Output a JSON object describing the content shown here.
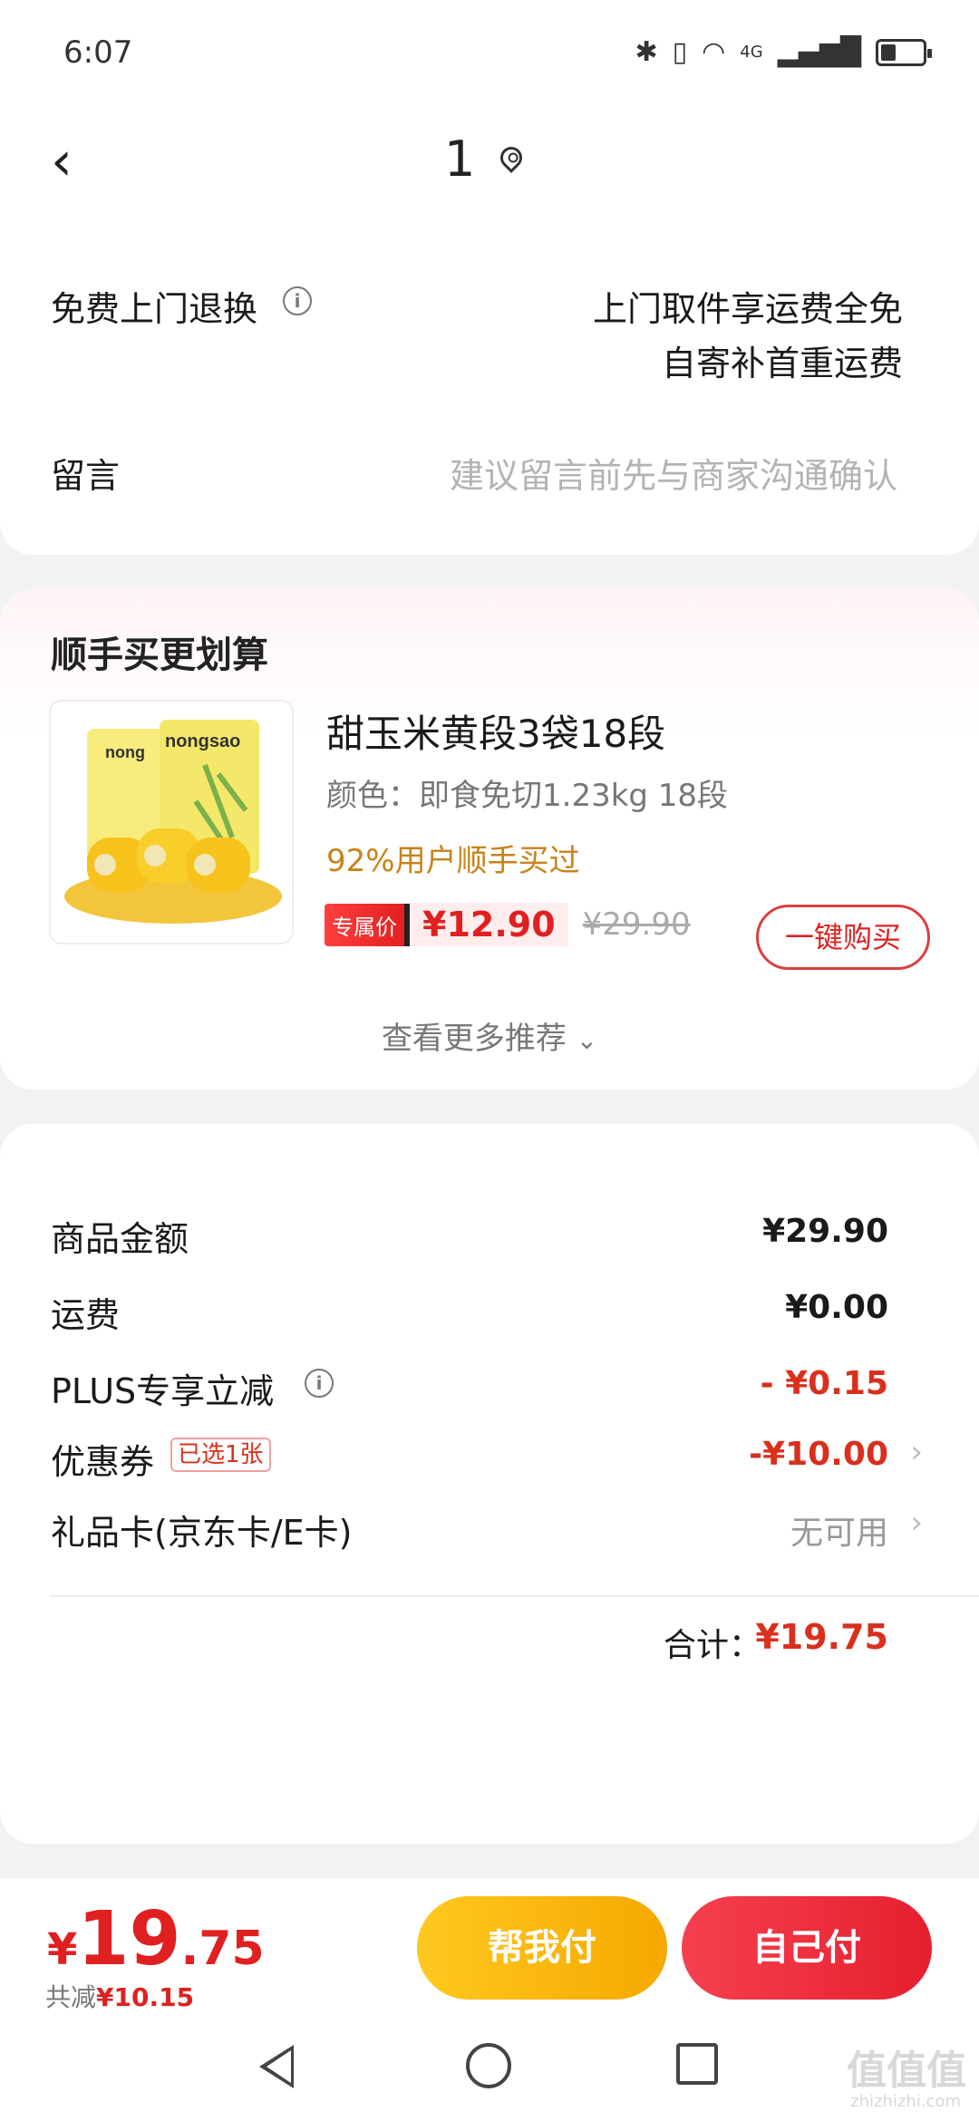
{
  "status_bar": {
    "time": "6:07",
    "network": "4G"
  },
  "nav": {
    "title": "1"
  },
  "service": {
    "return_label": "免费上门退换",
    "return_line1": "上门取件享运费全免",
    "return_line2": "自寄补首重运费",
    "note_label": "留言",
    "note_placeholder": "建议留言前先与商家沟通确认"
  },
  "recommend": {
    "title": "顺手买更划算",
    "product": {
      "name": "甜玉米黄段3袋18段",
      "spec": "颜色：即食免切1.23kg 18段",
      "bought": "92%用户顺手买过",
      "badge": "专属价",
      "price": "¥12.90",
      "original_price": "¥29.90",
      "buy_label": "一键购买",
      "brand": "nongsao"
    },
    "more_label": "查看更多推荐"
  },
  "summary": {
    "goods_label": "商品金额",
    "goods_value": "¥29.90",
    "shipping_label": "运费",
    "shipping_value": "¥0.00",
    "plus_label": "PLUS专享立减",
    "plus_value": "- ¥0.15",
    "coupon_label": "优惠券",
    "coupon_tag": "已选1张",
    "coupon_value": "-¥10.00",
    "giftcard_label": "礼品卡(京东卡/E卡)",
    "giftcard_value": "无可用",
    "total_label": "合计：",
    "total_value": "¥19.75"
  },
  "bottom": {
    "currency": "¥",
    "price_int": "19",
    "price_dec": ".75",
    "saved_label": "共减",
    "saved_value": "¥10.15",
    "help_pay": "帮我付",
    "self_pay": "自己付"
  },
  "watermark": {
    "text": "值值值",
    "url": "zhizhizhi.com"
  },
  "colors": {
    "accent_red": "#e02020",
    "yellow": "#ffc820",
    "coupon_red": "#d9301e"
  }
}
